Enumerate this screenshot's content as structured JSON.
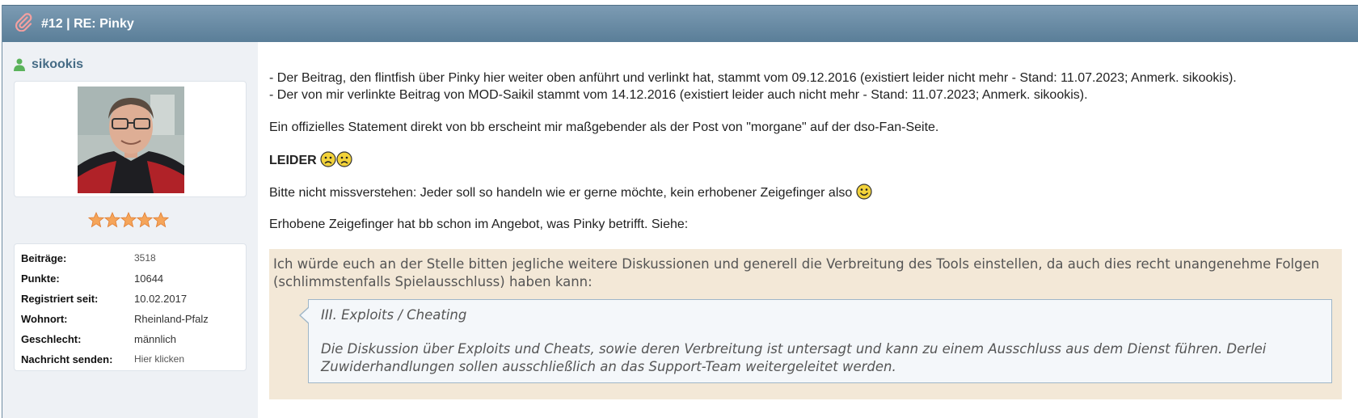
{
  "header": {
    "title": "#12 | RE: Pinky"
  },
  "author": {
    "username": "sikookis",
    "rating_stars": 5,
    "stats": [
      {
        "label": "Beiträge:",
        "value": "3518"
      },
      {
        "label": "Punkte:",
        "value": "10644"
      },
      {
        "label": "Registriert seit:",
        "value": "10.02.2017"
      },
      {
        "label": "Wohnort:",
        "value": "Rheinland-Pfalz"
      },
      {
        "label": "Geschlecht:",
        "value": "männlich"
      },
      {
        "label": "Nachricht senden:",
        "value": "Hier klicken"
      }
    ]
  },
  "post": {
    "line1": "- Der Beitrag, den flintfish über Pinky hier weiter oben anführt und verlinkt hat, stammt vom 09.12.2016 (existiert leider nicht mehr - Stand: 11.07.2023; Anmerk. sikookis).",
    "line2": "- Der von mir verlinkte Beitrag von MOD-Saikil stammt vom 14.12.2016 (existiert leider auch nicht mehr - Stand: 11.07.2023; Anmerk. sikookis).",
    "line3": "Ein offizielles Statement direkt von bb erscheint mir maßgebender als der Post von \"morgane\" auf der dso-Fan-Seite.",
    "leider": "LEIDER",
    "line4": "Bitte nicht missverstehen: Jeder soll so handeln wie er gerne möchte, kein erhobener Zeigefinger also",
    "line5": "Erhobene Zeigefinger hat bb schon im Angebot, was Pinky betrifft. Siehe:",
    "quote": {
      "text": "Ich würde euch an der Stelle bitten jegliche weitere Diskussionen und generell die Verbreitung des Tools einstellen, da auch dies recht unangenehme Folgen (schlimmstenfalls Spielausschluss) haben kann:",
      "inner_heading": "III. Exploits / Cheating",
      "inner_body": "Die Diskussion über Exploits und Cheats, sowie deren Verbreitung ist untersagt und kann zu einem Ausschluss aus dem Dienst führen. Derlei Zuwiderhandlungen sollen ausschließlich an das Support-Team weitergeleitet werden."
    }
  },
  "colors": {
    "header": "#6a8ba5",
    "username": "#456b85",
    "quote_bg": "#f3e8d7",
    "inner_quote_border": "#9fb6c8"
  }
}
